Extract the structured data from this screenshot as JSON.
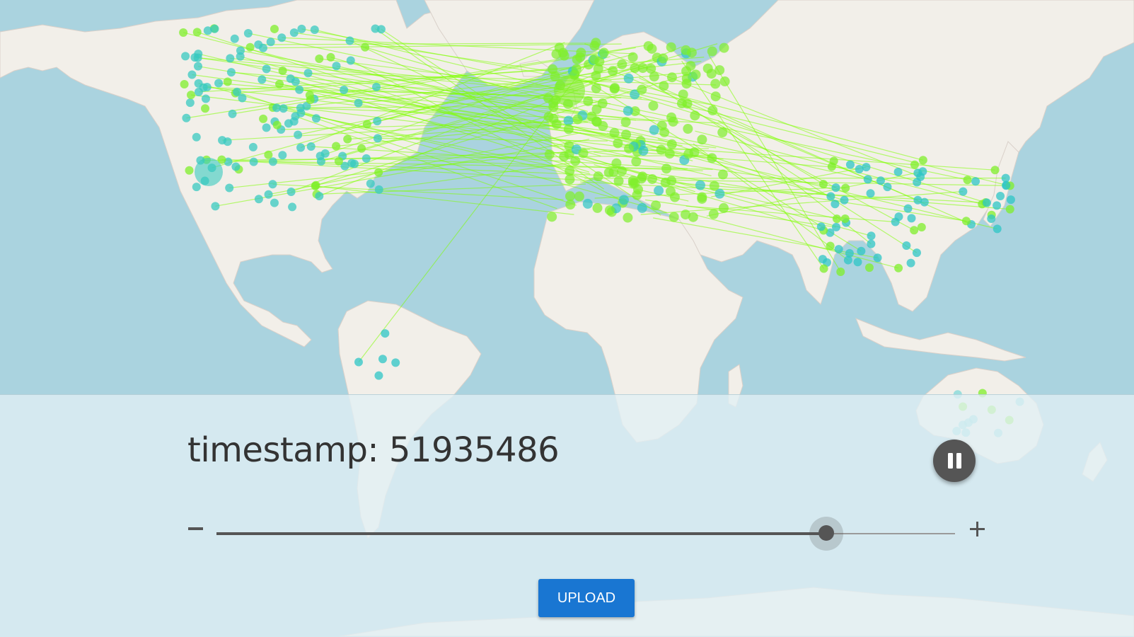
{
  "timestamp": {
    "label": "timestamp:",
    "value": "51935486"
  },
  "controls": {
    "pause_icon": "pause-icon",
    "minus_icon": "minus-icon",
    "plus_icon": "plus-icon",
    "slider_value": 0.826
  },
  "upload": {
    "label": "UPLOAD",
    "color": "#1976d2"
  },
  "map": {
    "water_color": "#aad3df",
    "land_color": "#f2efe9",
    "line_color": "#7fff00",
    "source_point_color": "#7fef2a",
    "destination_point_color": "#2ec5c5"
  }
}
